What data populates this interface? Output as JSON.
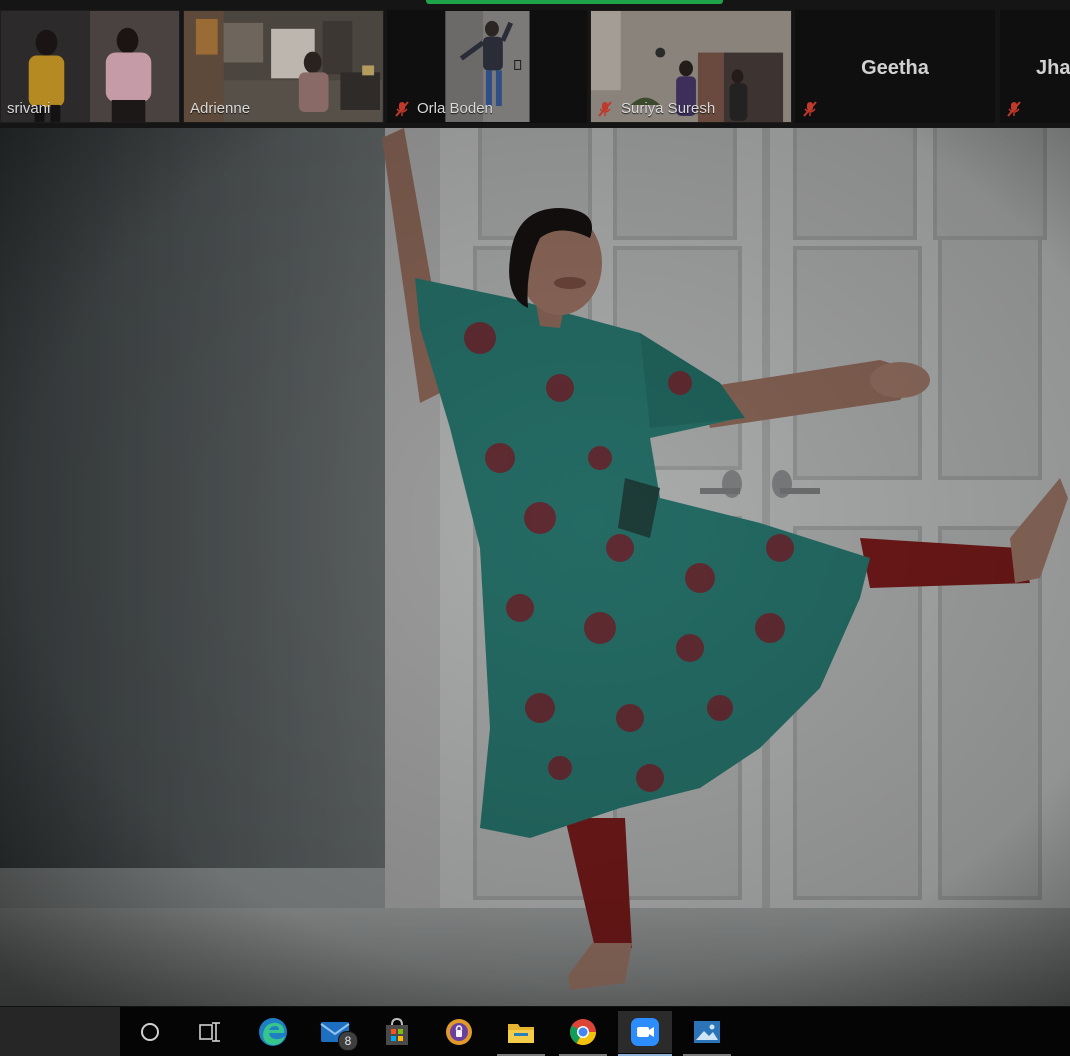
{
  "window": {
    "accent": "#1fa34a"
  },
  "participants": [
    {
      "name": "srivani",
      "muted": false,
      "video": true
    },
    {
      "name": "Adrienne",
      "muted": false,
      "video": true
    },
    {
      "name": "Orla Boden",
      "muted": true,
      "video": true
    },
    {
      "name": "Suriya Suresh",
      "muted": true,
      "video": true
    },
    {
      "name": "Geetha",
      "muted": true,
      "video": false
    },
    {
      "name": "Jha",
      "muted": true,
      "video": false
    }
  ],
  "icons": {
    "muted": "mic-muted-icon",
    "cortana": "cortana-circle-icon",
    "task_view": "task-view-icon",
    "edge": "edge-icon",
    "mail": "mail-icon",
    "store": "store-icon",
    "vpn": "vpn-icon",
    "explorer": "file-explorer-icon",
    "chrome": "chrome-icon",
    "zoom": "zoom-icon",
    "photos": "photos-icon"
  },
  "taskbar": {
    "mail_badge": "8"
  }
}
